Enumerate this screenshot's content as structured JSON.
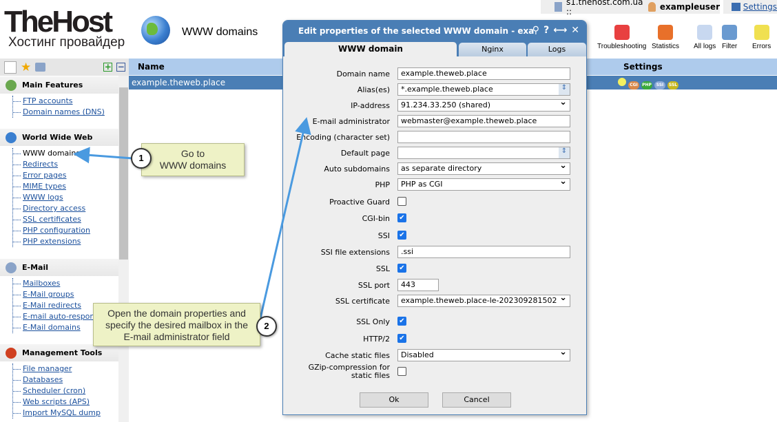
{
  "logo": {
    "name": "TheHost",
    "tagline": "Хостинг провайдер"
  },
  "header": {
    "title": "WWW domains",
    "server": "s1.thehost.com.ua ::",
    "user": "exampleuser",
    "settings": "Settings"
  },
  "toolbar": [
    {
      "label": "Troubleshooting",
      "icon": "first-aid-icon"
    },
    {
      "label": "Statistics",
      "icon": "pie-chart-icon"
    },
    {
      "label": "All logs",
      "icon": "logs-icon"
    },
    {
      "label": "Filter",
      "icon": "filter-icon"
    },
    {
      "label": "Errors",
      "icon": "warning-icon"
    }
  ],
  "sidebar": {
    "sections": [
      {
        "title": "Main Features",
        "items": [
          "FTP accounts",
          "Domain names (DNS)"
        ]
      },
      {
        "title": "World Wide Web",
        "items": [
          "WWW domains",
          "Redirects",
          "Error pages",
          "MIME types",
          "WWW logs",
          "Directory access",
          "SSL certificates",
          "PHP configuration",
          "PHP extensions"
        ]
      },
      {
        "title": "E-Mail",
        "items": [
          "Mailboxes",
          "E-Mail groups",
          "E-Mail redirects",
          "E-mail auto-responders",
          "E-Mail domains"
        ]
      },
      {
        "title": "Management Tools",
        "items": [
          "File manager",
          "Databases",
          "Scheduler (cron)",
          "Web scripts (APS)",
          "Import MySQL dump"
        ]
      }
    ]
  },
  "table": {
    "columns": [
      "Name",
      "Settings"
    ],
    "rows": [
      {
        "name": "example.theweb.place",
        "badges": [
          "CGI",
          "PHP",
          "SSI",
          "SSL"
        ]
      }
    ]
  },
  "dialog": {
    "title": "Edit properties of the selected WWW domain - exa",
    "tabs": [
      "WWW domain",
      "Nginx",
      "Logs"
    ],
    "fields": [
      {
        "label": "Domain name",
        "type": "text",
        "value": "example.theweb.place"
      },
      {
        "label": "Alias(es)",
        "type": "spin",
        "value": "*.example.theweb.place"
      },
      {
        "label": "IP-address",
        "type": "select",
        "value": "91.234.33.250 (shared)"
      },
      {
        "label": "E-mail administrator",
        "type": "text",
        "value": "webmaster@example.theweb.place"
      },
      {
        "label": "Encoding (character set)",
        "type": "text",
        "value": ""
      },
      {
        "label": "Default page",
        "type": "spin",
        "value": ""
      },
      {
        "label": "Auto subdomains",
        "type": "select",
        "value": "as separate directory"
      },
      {
        "label": "PHP",
        "type": "select",
        "value": "PHP as CGI"
      },
      {
        "label": "Proactive Guard",
        "type": "check",
        "value": false
      },
      {
        "label": "CGI-bin",
        "type": "check",
        "value": true
      },
      {
        "label": "SSI",
        "type": "check",
        "value": true
      },
      {
        "label": "SSI file extensions",
        "type": "text",
        "value": ".ssi"
      },
      {
        "label": "SSL",
        "type": "check",
        "value": true
      },
      {
        "label": "SSL port",
        "type": "short",
        "value": "443"
      },
      {
        "label": "SSL certificate",
        "type": "select",
        "value": "example.theweb.place-le-202309281502"
      },
      {
        "label": "SSL Only",
        "type": "check",
        "value": true
      },
      {
        "label": "HTTP/2",
        "type": "check",
        "value": true
      },
      {
        "label": "Cache static files",
        "type": "select",
        "value": "Disabled"
      },
      {
        "label": "GZip-compression for static files",
        "type": "check",
        "value": false
      }
    ],
    "ok": "Ok",
    "cancel": "Cancel"
  },
  "callouts": [
    {
      "number": "1",
      "text": "Go to\nWWW domains"
    },
    {
      "number": "2",
      "text": "Open the domain properties and specify the desired mailbox in the E-mail administrator field"
    }
  ]
}
